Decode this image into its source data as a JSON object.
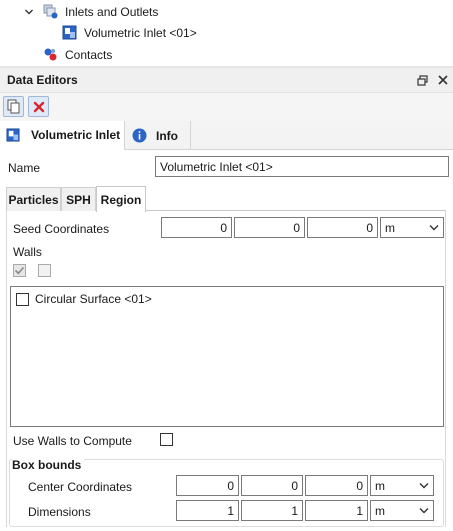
{
  "tree": {
    "inlets_label": "Inlets and Outlets",
    "volumetric_label": "Volumetric Inlet <01>",
    "contacts_label": "Contacts"
  },
  "panel": {
    "title": "Data Editors"
  },
  "tabs": {
    "volumetric_inlet": "Volumetric Inlet",
    "info": "Info"
  },
  "name_field": {
    "label": "Name",
    "value": "Volumetric Inlet <01>"
  },
  "sub_tabs": {
    "particles": "Particles",
    "sph": "SPH",
    "region": "Region"
  },
  "region": {
    "seed_label": "Seed Coordinates",
    "seed": [
      "0",
      "0",
      "0"
    ],
    "seed_unit": "m",
    "walls_label": "Walls",
    "wall_items": [
      "Circular Surface <01>"
    ],
    "use_walls_label": "Use Walls to Compute",
    "box_bounds_label": "Box bounds",
    "center_label": "Center Coordinates",
    "center": [
      "0",
      "0",
      "0"
    ],
    "center_unit": "m",
    "dimensions_label": "Dimensions",
    "dimensions": [
      "1",
      "1",
      "1"
    ],
    "dimensions_unit": "m"
  },
  "colors": {
    "accent": "#2b63c7",
    "delete_red": "#d9262e"
  }
}
